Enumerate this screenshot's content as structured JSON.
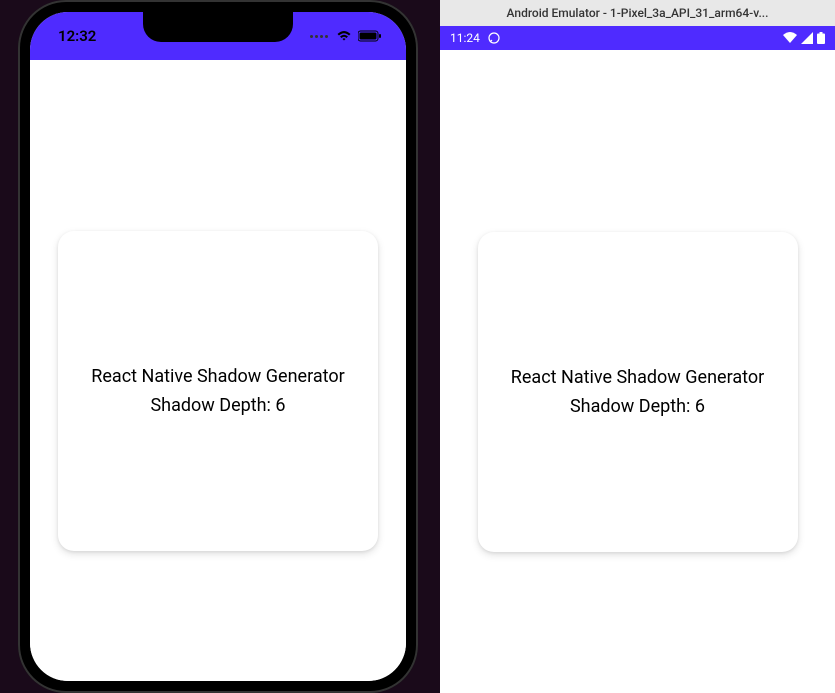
{
  "ios": {
    "status": {
      "time": "12:32"
    },
    "card": {
      "title": "React Native Shadow Generator",
      "subtitle": "Shadow Depth: 6"
    }
  },
  "android": {
    "window_title": "Android Emulator - 1-Pixel_3a_API_31_arm64-v...",
    "status": {
      "time": "11:24"
    },
    "card": {
      "title": "React Native Shadow Generator",
      "subtitle": "Shadow Depth: 6"
    }
  },
  "colors": {
    "accent": "#4f2bff"
  }
}
